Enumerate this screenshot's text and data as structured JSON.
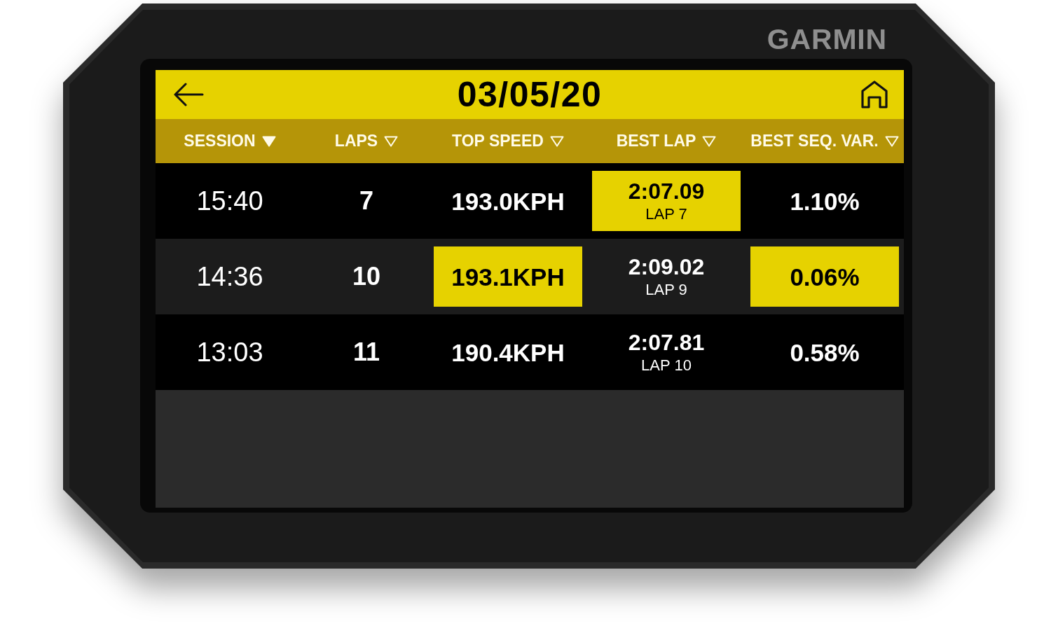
{
  "device": {
    "brand": "GARMIN"
  },
  "screen": {
    "header": {
      "title": "03/05/20"
    },
    "table": {
      "columns": [
        {
          "label": "SESSION",
          "sorted": true
        },
        {
          "label": "LAPS",
          "sorted": false
        },
        {
          "label": "TOP SPEED",
          "sorted": false
        },
        {
          "label": "BEST LAP",
          "sorted": false
        },
        {
          "label": "BEST SEQ. VAR.",
          "sorted": false
        }
      ],
      "rows": [
        {
          "cells": [
            {
              "kind": "time",
              "text": "15:40"
            },
            {
              "kind": "count",
              "text": "7"
            },
            {
              "kind": "value",
              "text": "193.0KPH",
              "highlighted": false
            },
            {
              "kind": "lap",
              "text": "2:07.09",
              "lap": "LAP 7",
              "highlighted": true
            },
            {
              "kind": "value",
              "text": "1.10%",
              "highlighted": false
            }
          ]
        },
        {
          "cells": [
            {
              "kind": "time",
              "text": "14:36"
            },
            {
              "kind": "count",
              "text": "10"
            },
            {
              "kind": "value",
              "text": "193.1KPH",
              "highlighted": true
            },
            {
              "kind": "lap",
              "text": "2:09.02",
              "lap": "LAP 9",
              "highlighted": false
            },
            {
              "kind": "value",
              "text": "0.06%",
              "highlighted": true
            }
          ]
        },
        {
          "cells": [
            {
              "kind": "time",
              "text": "13:03"
            },
            {
              "kind": "count",
              "text": "11"
            },
            {
              "kind": "value",
              "text": "190.4KPH",
              "highlighted": false
            },
            {
              "kind": "lap",
              "text": "2:07.81",
              "lap": "LAP 10",
              "highlighted": false
            },
            {
              "kind": "value",
              "text": "0.58%",
              "highlighted": false
            }
          ]
        }
      ]
    }
  }
}
